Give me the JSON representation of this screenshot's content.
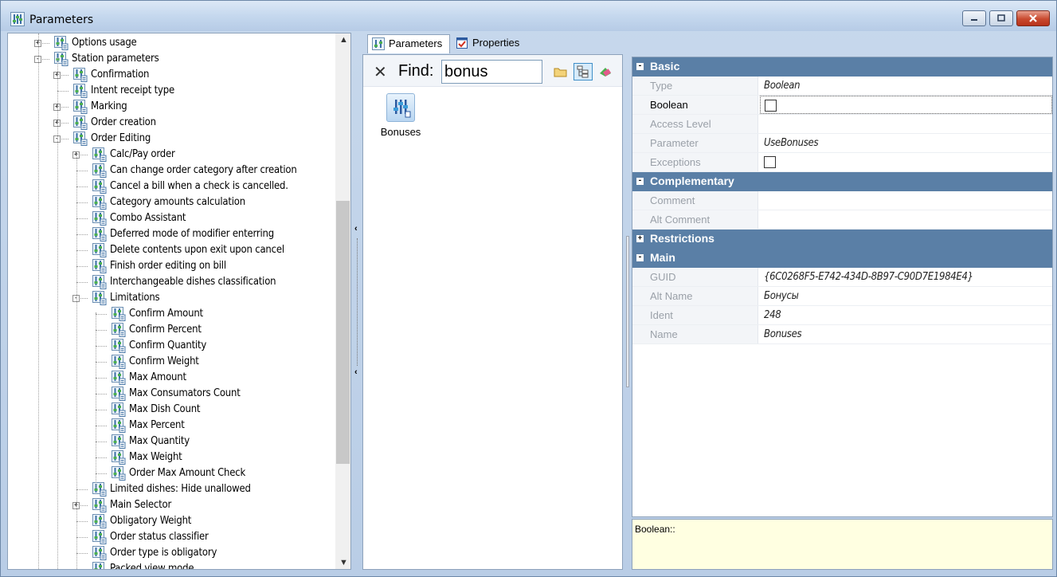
{
  "window": {
    "title": "Parameters"
  },
  "tree": {
    "items": [
      {
        "label": "Options usage",
        "level": 1,
        "expander": "+"
      },
      {
        "label": "Station parameters",
        "level": 1,
        "expander": "-"
      },
      {
        "label": "Confirmation",
        "level": 2,
        "expander": "+"
      },
      {
        "label": "Intent receipt type",
        "level": 2,
        "expander": ""
      },
      {
        "label": "Marking",
        "level": 2,
        "expander": "+"
      },
      {
        "label": "Order creation",
        "level": 2,
        "expander": "+"
      },
      {
        "label": "Order Editing",
        "level": 2,
        "expander": "-"
      },
      {
        "label": "Calc/Pay order",
        "level": 3,
        "expander": "+"
      },
      {
        "label": "Can change order category after creation",
        "level": 3,
        "expander": ""
      },
      {
        "label": "Cancel a bill when a check is cancelled.",
        "level": 3,
        "expander": ""
      },
      {
        "label": "Category amounts calculation",
        "level": 3,
        "expander": ""
      },
      {
        "label": "Combo Assistant",
        "level": 3,
        "expander": ""
      },
      {
        "label": "Deferred mode of modifier enterring",
        "level": 3,
        "expander": ""
      },
      {
        "label": "Delete contents upon exit upon cancel",
        "level": 3,
        "expander": ""
      },
      {
        "label": "Finish order editing on bill",
        "level": 3,
        "expander": ""
      },
      {
        "label": "Interchangeable dishes classification",
        "level": 3,
        "expander": ""
      },
      {
        "label": "Limitations",
        "level": 3,
        "expander": "-"
      },
      {
        "label": "Confirm Amount",
        "level": 4,
        "expander": ""
      },
      {
        "label": "Confirm Percent",
        "level": 4,
        "expander": ""
      },
      {
        "label": "Confirm Quantity",
        "level": 4,
        "expander": ""
      },
      {
        "label": "Confirm Weight",
        "level": 4,
        "expander": ""
      },
      {
        "label": "Max Amount",
        "level": 4,
        "expander": ""
      },
      {
        "label": "Max Consumators Count",
        "level": 4,
        "expander": ""
      },
      {
        "label": "Max Dish Count",
        "level": 4,
        "expander": ""
      },
      {
        "label": "Max Percent",
        "level": 4,
        "expander": ""
      },
      {
        "label": "Max Quantity",
        "level": 4,
        "expander": ""
      },
      {
        "label": "Max Weight",
        "level": 4,
        "expander": ""
      },
      {
        "label": "Order Max Amount Check",
        "level": 4,
        "expander": ""
      },
      {
        "label": "Limited dishes: Hide unallowed",
        "level": 3,
        "expander": ""
      },
      {
        "label": "Main Selector",
        "level": 3,
        "expander": "+"
      },
      {
        "label": "Obligatory Weight",
        "level": 3,
        "expander": ""
      },
      {
        "label": "Order status classifier",
        "level": 3,
        "expander": ""
      },
      {
        "label": "Order type is obligatory",
        "level": 3,
        "expander": ""
      },
      {
        "label": "Packed view mode",
        "level": 3,
        "expander": ""
      }
    ]
  },
  "tabs": [
    {
      "label": "Parameters",
      "active": true
    },
    {
      "label": "Properties",
      "active": false
    }
  ],
  "find": {
    "label": "Find:",
    "value": "bonus"
  },
  "results": [
    {
      "label": "Bonuses"
    }
  ],
  "property_grid": {
    "categories": [
      {
        "name": "Basic",
        "expander": "-",
        "rows": [
          {
            "name": "Type",
            "value": "Boolean",
            "strong": false
          },
          {
            "name": "Boolean",
            "value": "",
            "checkbox": true,
            "strong": true,
            "focused": true
          },
          {
            "name": "Access Level",
            "value": "",
            "strong": false
          },
          {
            "name": "Parameter",
            "value": "UseBonuses",
            "strong": false
          },
          {
            "name": "Exceptions",
            "value": "",
            "checkbox": true,
            "strong": false
          }
        ]
      },
      {
        "name": "Complementary",
        "expander": "-",
        "rows": [
          {
            "name": "Comment",
            "value": "",
            "strong": false
          },
          {
            "name": "Alt Comment",
            "value": "",
            "strong": false
          }
        ]
      },
      {
        "name": "Restrictions",
        "expander": "+",
        "rows": []
      },
      {
        "name": "Main",
        "expander": "-",
        "rows": [
          {
            "name": "GUID",
            "value": "{6C0268F5-E742-434D-8B97-C90D7E1984E4}",
            "strong": false
          },
          {
            "name": "Alt Name",
            "value": "Бонусы",
            "strong": false
          },
          {
            "name": "Ident",
            "value": "248",
            "strong": false
          },
          {
            "name": "Name",
            "value": "Bonuses",
            "strong": false
          }
        ]
      }
    ]
  },
  "description": {
    "text": "Boolean::"
  },
  "colors": {
    "category_header": "#5a7fa6",
    "description_bg": "#ffffe1",
    "window_frame": "#c7d8ec"
  }
}
